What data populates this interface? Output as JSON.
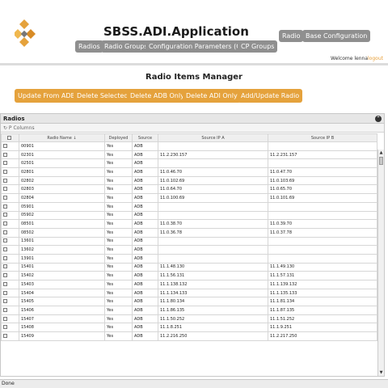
{
  "app": {
    "title": "SBSS.ADI.Application"
  },
  "nav": {
    "radios": "Radios",
    "radio_groups": "Radio Groups",
    "config_params": "Configuration Parameters (CP)",
    "cp_groups": "CP Groups",
    "radio": "Radio",
    "base_config": "Base Configuration"
  },
  "user": {
    "welcome": "Welcome lenna",
    "logout": "logout"
  },
  "page": {
    "title": "Radio Items Manager"
  },
  "actions": {
    "update_from_adb": "Update From ADB",
    "delete_selected": "Delete Selected",
    "delete_adb_only": "Delete ADB Only",
    "delete_adi_only": "Delete ADI Only",
    "add_update_radio": "Add/Update Radio"
  },
  "grid": {
    "title": "Radios",
    "columns_toolbar": "↻  P Columns",
    "headers": [
      "Radio Name ↓",
      "Deployed",
      "Source",
      "Source IP A",
      "Source IP B"
    ],
    "rows": [
      [
        "00901",
        "Yes",
        "ADB",
        "",
        ""
      ],
      [
        "02301",
        "Yes",
        "ADB",
        "11.2.230.157",
        "11.2.231.157"
      ],
      [
        "02501",
        "Yes",
        "ADB",
        "",
        ""
      ],
      [
        "02801",
        "Yes",
        "ADB",
        "11.0.46.70",
        "11.0.47.70"
      ],
      [
        "02802",
        "Yes",
        "ADB",
        "11.0.102.69",
        "11.0.103.69"
      ],
      [
        "02803",
        "Yes",
        "ADB",
        "11.0.64.70",
        "11.0.65.70"
      ],
      [
        "02804",
        "Yes",
        "ADB",
        "11.0.100.69",
        "11.0.101.69"
      ],
      [
        "05901",
        "Yes",
        "ADB",
        "",
        ""
      ],
      [
        "05902",
        "Yes",
        "ADB",
        "",
        ""
      ],
      [
        "08501",
        "Yes",
        "ADB",
        "11.0.38.70",
        "11.0.39.70"
      ],
      [
        "08502",
        "Yes",
        "ADB",
        "11.0.36.78",
        "11.0.37.78"
      ],
      [
        "13601",
        "Yes",
        "ADB",
        "",
        ""
      ],
      [
        "13602",
        "Yes",
        "ADB",
        "",
        ""
      ],
      [
        "13901",
        "Yes",
        "ADB",
        "",
        ""
      ],
      [
        "15401",
        "Yes",
        "ADB",
        "11.1.48.130",
        "11.1.49.130"
      ],
      [
        "15402",
        "Yes",
        "ADB",
        "11.1.56.131",
        "11.1.57.131"
      ],
      [
        "15403",
        "Yes",
        "ADB",
        "11.1.138.132",
        "11.1.139.132"
      ],
      [
        "15404",
        "Yes",
        "ADB",
        "11.1.134.133",
        "11.1.135.133"
      ],
      [
        "15405",
        "Yes",
        "ADB",
        "11.1.80.134",
        "11.1.81.134"
      ],
      [
        "15406",
        "Yes",
        "ADB",
        "11.1.86.135",
        "11.1.87.135"
      ],
      [
        "15407",
        "Yes",
        "ADB",
        "11.1.50.252",
        "11.1.51.252"
      ],
      [
        "15408",
        "Yes",
        "ADB",
        "11.1.8.251",
        "11.1.9.251"
      ],
      [
        "15409",
        "Yes",
        "ADB",
        "11.2.216.250",
        "11.2.217.250"
      ]
    ]
  },
  "status": {
    "text": "Done"
  },
  "colors": {
    "accent": "#e5a23c",
    "nav_button": "#8f8f8f"
  }
}
